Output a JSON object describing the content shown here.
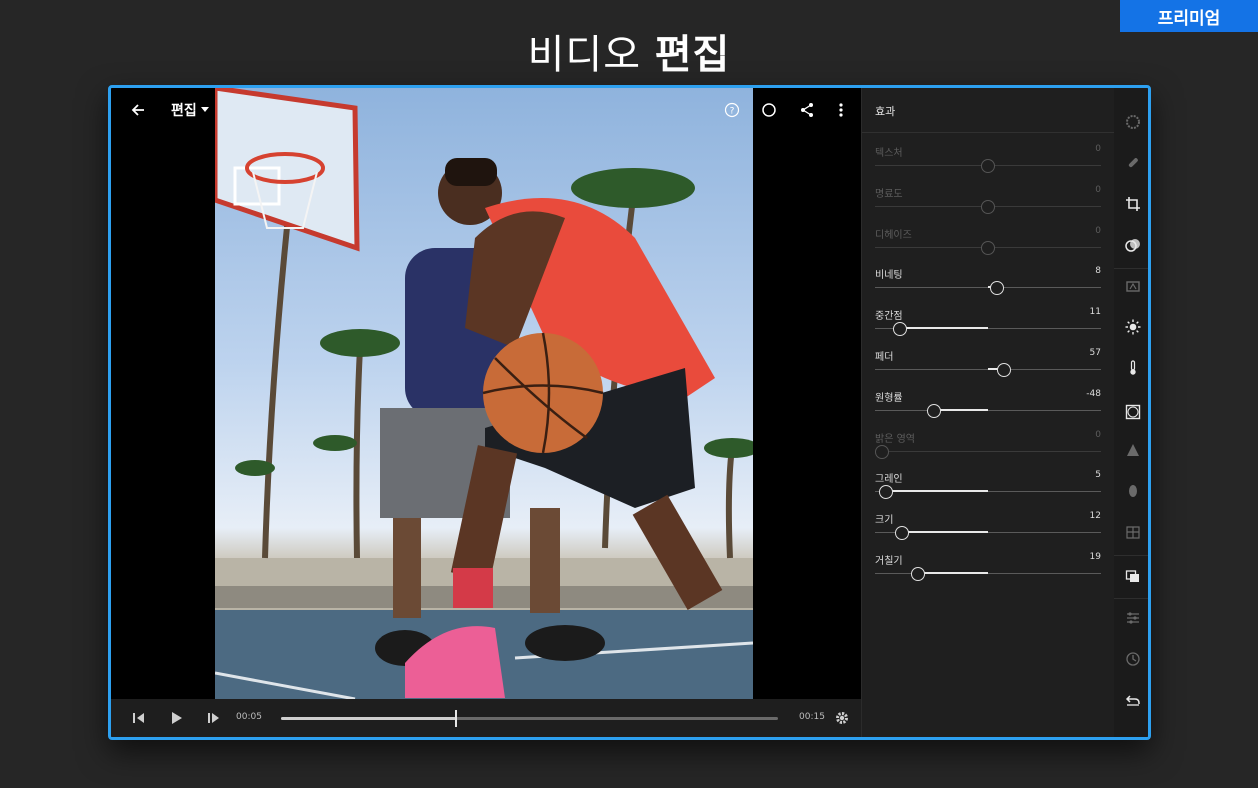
{
  "premium_label": "프리미엄",
  "headline": {
    "light": "비디오",
    "bold": "편집"
  },
  "viewer": {
    "mode_label": "편집"
  },
  "transport": {
    "current_time": "00:05",
    "end_time": "00:15",
    "progress": 0.353
  },
  "panel": {
    "title": "효과",
    "sliders": [
      {
        "label": "텍스처",
        "value": "0",
        "position": 0.5,
        "disabled": true
      },
      {
        "label": "명료도",
        "value": "0",
        "position": 0.5,
        "disabled": true
      },
      {
        "label": "디헤이즈",
        "value": "0",
        "position": 0.5,
        "disabled": true
      },
      {
        "label": "비네팅",
        "value": "8",
        "position": 0.54,
        "disabled": false
      },
      {
        "label": "중간점",
        "value": "11",
        "position": 0.11,
        "disabled": false
      },
      {
        "label": "페더",
        "value": "57",
        "position": 0.57,
        "disabled": false
      },
      {
        "label": "원형률",
        "value": "-48",
        "position": 0.26,
        "disabled": false
      },
      {
        "label": "밝은 영역",
        "value": "0",
        "position": 0.0,
        "disabled": true
      },
      {
        "label": "그레인",
        "value": "5",
        "position": 0.05,
        "disabled": false
      },
      {
        "label": "크기",
        "value": "12",
        "position": 0.12,
        "disabled": false
      },
      {
        "label": "거칠기",
        "value": "19",
        "position": 0.19,
        "disabled": false
      }
    ]
  },
  "colors": {
    "accent": "#2da0f0",
    "premium": "#1473e6"
  }
}
